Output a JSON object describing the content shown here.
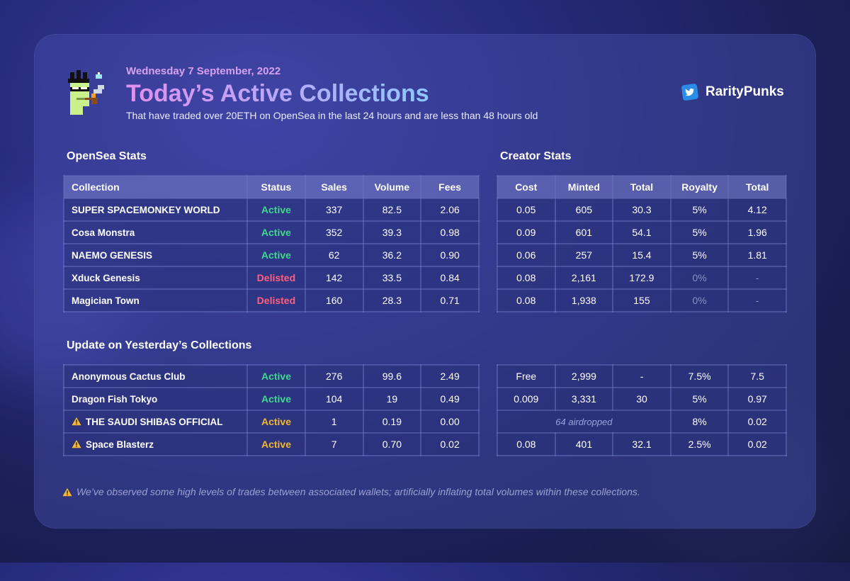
{
  "header": {
    "date": "Wednesday 7 September, 2022",
    "title": "Today’s Active Collections",
    "subtitle": "That have traded over 20ETH on OpenSea in the last 24 hours and are less than 48 hours old"
  },
  "brand": {
    "name": "RarityPunks",
    "icon": "twitter-bird-icon"
  },
  "sections": {
    "opensea": "OpenSea Stats",
    "creator": "Creator Stats",
    "yesterday": "Update on Yesterday’s Collections"
  },
  "opensea_headers": [
    "Collection",
    "Status",
    "Sales",
    "Volume",
    "Fees"
  ],
  "creator_headers": [
    "Cost",
    "Minted",
    "Total",
    "Royalty",
    "Total"
  ],
  "today": [
    {
      "name": "SUPER SPACEMONKEY WORLD",
      "status": "Active",
      "sales": "337",
      "volume": "82.5",
      "fees": "2.06",
      "cost": "0.05",
      "minted": "605",
      "total": "30.3",
      "royalty": "5%",
      "ctotal": "4.12"
    },
    {
      "name": "Cosa Monstra",
      "status": "Active",
      "sales": "352",
      "volume": "39.3",
      "fees": "0.98",
      "cost": "0.09",
      "minted": "601",
      "total": "54.1",
      "royalty": "5%",
      "ctotal": "1.96"
    },
    {
      "name": "NAEMO GENESIS",
      "status": "Active",
      "sales": "62",
      "volume": "36.2",
      "fees": "0.90",
      "cost": "0.06",
      "minted": "257",
      "total": "15.4",
      "royalty": "5%",
      "ctotal": "1.81"
    },
    {
      "name": "Xduck Genesis",
      "status": "Delisted",
      "sales": "142",
      "volume": "33.5",
      "fees": "0.84",
      "cost": "0.08",
      "minted": "2,161",
      "total": "172.9",
      "royalty": "0%",
      "ctotal": "-"
    },
    {
      "name": "Magician Town",
      "status": "Delisted",
      "sales": "160",
      "volume": "28.3",
      "fees": "0.71",
      "cost": "0.08",
      "minted": "1,938",
      "total": "155",
      "royalty": "0%",
      "ctotal": "-"
    }
  ],
  "yesterday": [
    {
      "name": "Anonymous Cactus Club",
      "status": "Active",
      "sales": "276",
      "volume": "99.6",
      "fees": "2.49",
      "cost": "Free",
      "minted": "2,999",
      "total": "-",
      "royalty": "7.5%",
      "ctotal": "7.5"
    },
    {
      "name": "Dragon Fish Tokyo",
      "status": "Active",
      "sales": "104",
      "volume": "19",
      "fees": "0.49",
      "cost": "0.009",
      "minted": "3,331",
      "total": "30",
      "royalty": "5%",
      "ctotal": "0.97"
    },
    {
      "name": "THE SAUDI SHIBAS OFFICIAL",
      "status": "Active",
      "sales": "1",
      "volume": "0.19",
      "fees": "0.00",
      "airdrop": "64 airdropped",
      "royalty": "8%",
      "ctotal": "0.02",
      "warning": true
    },
    {
      "name": "Space Blasterz",
      "status": "Active",
      "sales": "7",
      "volume": "0.70",
      "fees": "0.02",
      "cost": "0.08",
      "minted": "401",
      "total": "32.1",
      "royalty": "2.5%",
      "ctotal": "0.02",
      "warning": true
    }
  ],
  "footer": {
    "icon": "warning-icon",
    "note": "We’ve observed some high levels of trades between associated wallets; artificially inflating total volumes within these collections."
  },
  "colors": {
    "active": "#3fd98e",
    "delisted": "#ff5f7e",
    "warning": "#f5b830"
  }
}
